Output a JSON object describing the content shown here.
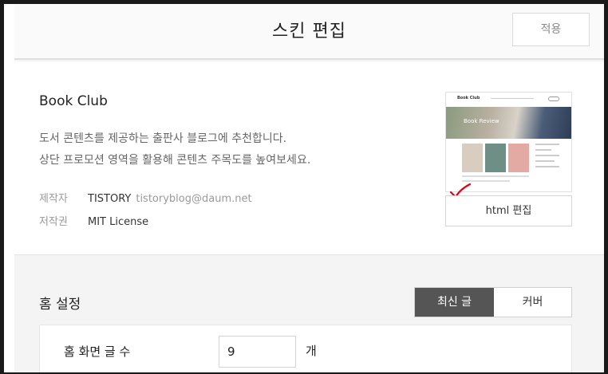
{
  "header": {
    "title": "스킨 편집",
    "apply_label": "적용"
  },
  "skin": {
    "name": "Book Club",
    "description_line1": "도서 콘텐츠를 제공하는 출판사 블로그에 추천합니다.",
    "description_line2": "상단 프로모션 영역을 활용해 콘텐츠 주목도를 높여보세요.",
    "author_label": "제작자",
    "author_name": "TISTORY",
    "author_email": "tistoryblog@daum.net",
    "license_label": "저작권",
    "license_value": "MIT License",
    "thumbnail": {
      "site_title": "Book Club",
      "banner_text": "Book Review"
    },
    "html_edit_label": "html 편집"
  },
  "home_settings": {
    "title": "홈 설정",
    "options": [
      {
        "label": "최신 글",
        "active": true
      },
      {
        "label": "커버",
        "active": false
      }
    ],
    "post_count_label": "홈 화면 글 수",
    "post_count_value": "9",
    "post_count_unit": "개"
  },
  "colors": {
    "accent_active": "#555555",
    "check_mark": "#e60012"
  },
  "icons": {
    "check": "red-check-mark-icon"
  }
}
